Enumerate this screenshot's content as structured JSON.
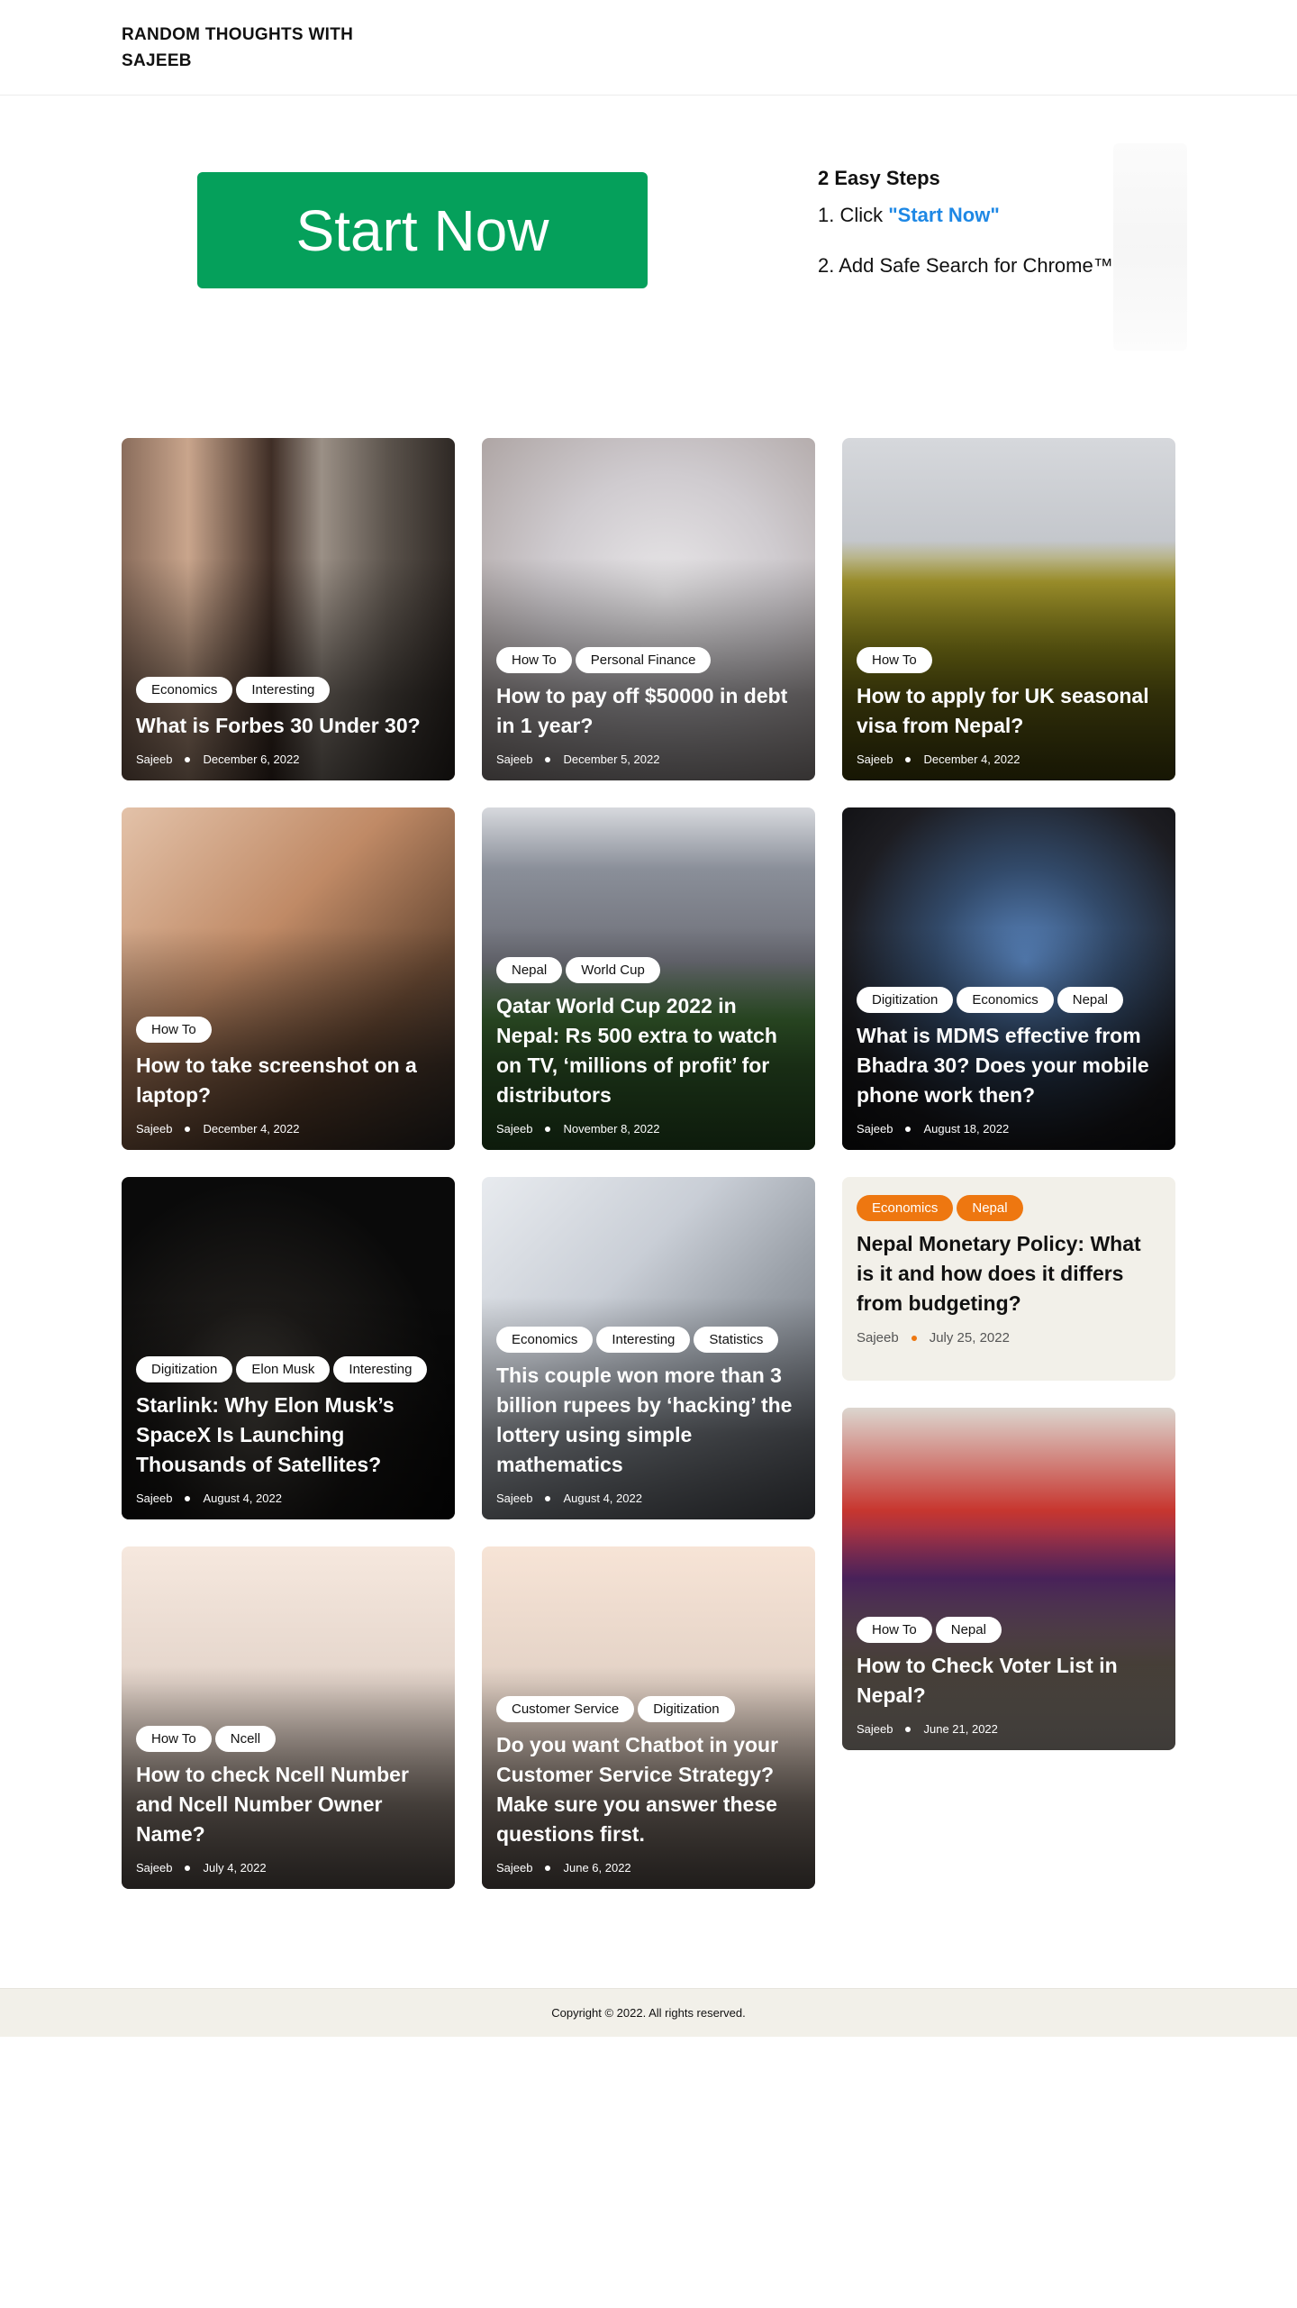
{
  "site": {
    "title": "RANDOM THOUGHTS WITH SAJEEB"
  },
  "hero": {
    "cta_label": "Start Now",
    "steps_heading": "2 Easy Steps",
    "step1_prefix": "1. Click ",
    "step1_link": "\"Start Now\"",
    "step2": "2. Add Safe Search for Chrome™",
    "accent_color": "#05a05b",
    "link_color": "#1e88e5"
  },
  "posts": [
    {
      "title": "What is Forbes 30 Under 30?",
      "tags": [
        "Economics",
        "Interesting"
      ],
      "author": "Sajeeb",
      "date": "December 6, 2022"
    },
    {
      "title": "How to pay off $50000 in debt in 1 year?",
      "tags": [
        "How To",
        "Personal Finance"
      ],
      "author": "Sajeeb",
      "date": "December 5, 2022"
    },
    {
      "title": "How to apply for UK seasonal visa from Nepal?",
      "tags": [
        "How To"
      ],
      "author": "Sajeeb",
      "date": "December 4, 2022"
    },
    {
      "title": "How to take screenshot on a laptop?",
      "tags": [
        "How To"
      ],
      "author": "Sajeeb",
      "date": "December 4, 2022"
    },
    {
      "title": "Qatar World Cup 2022 in Nepal: Rs 500 extra to watch on TV, ‘millions of profit’ for distributors",
      "tags": [
        "Nepal",
        "World Cup"
      ],
      "author": "Sajeeb",
      "date": "November 8, 2022"
    },
    {
      "title": "What is MDMS effective from Bhadra 30? Does your mobile phone work then?",
      "tags": [
        "Digitization",
        "Economics",
        "Nepal"
      ],
      "author": "Sajeeb",
      "date": "August 18, 2022"
    },
    {
      "title": "Starlink: Why Elon Musk’s SpaceX Is Launching Thousands of Satellites?",
      "tags": [
        "Digitization",
        "Elon Musk",
        "Interesting"
      ],
      "author": "Sajeeb",
      "date": "August 4, 2022"
    },
    {
      "title": "This couple won more than 3 billion rupees by ‘hacking’ the lottery using simple mathematics",
      "tags": [
        "Economics",
        "Interesting",
        "Statistics"
      ],
      "author": "Sajeeb",
      "date": "August 4, 2022"
    },
    {
      "title": "Nepal Monetary Policy: What is it and how does it differs from budgeting?",
      "tags": [
        "Economics",
        "Nepal"
      ],
      "author": "Sajeeb",
      "date": "July 25, 2022"
    },
    {
      "title": "How to Check Voter List in Nepal?",
      "tags": [
        "How To",
        "Nepal"
      ],
      "author": "Sajeeb",
      "date": "June 21, 2022"
    },
    {
      "title": "How to check Ncell Number and Ncell Number Owner Name?",
      "tags": [
        "How To",
        "Ncell"
      ],
      "author": "Sajeeb",
      "date": "July 4, 2022"
    },
    {
      "title": "Do you want Chatbot in your Customer Service Strategy? Make sure you answer these questions first.",
      "tags": [
        "Customer Service",
        "Digitization"
      ],
      "author": "Sajeeb",
      "date": "June 6, 2022"
    }
  ],
  "footer": {
    "copyright": "Copyright © 2022. All rights reserved."
  }
}
